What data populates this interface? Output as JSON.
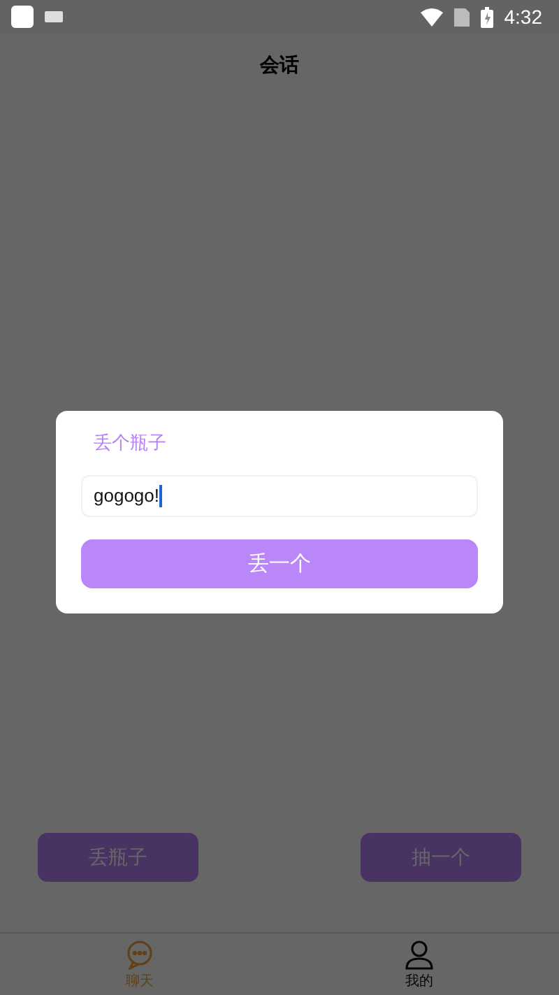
{
  "status_bar": {
    "time": "4:32"
  },
  "header": {
    "title": "会话"
  },
  "actions": [
    "丢瓶子",
    "抽一个"
  ],
  "tabs": [
    {
      "label": "聊天",
      "selected": true,
      "kind": "chat"
    },
    {
      "label": "我的",
      "selected": false,
      "kind": "user"
    }
  ],
  "dialog": {
    "title": "丢个瓶子",
    "input": {
      "value": "gogogo!"
    },
    "button": "丢一个"
  }
}
